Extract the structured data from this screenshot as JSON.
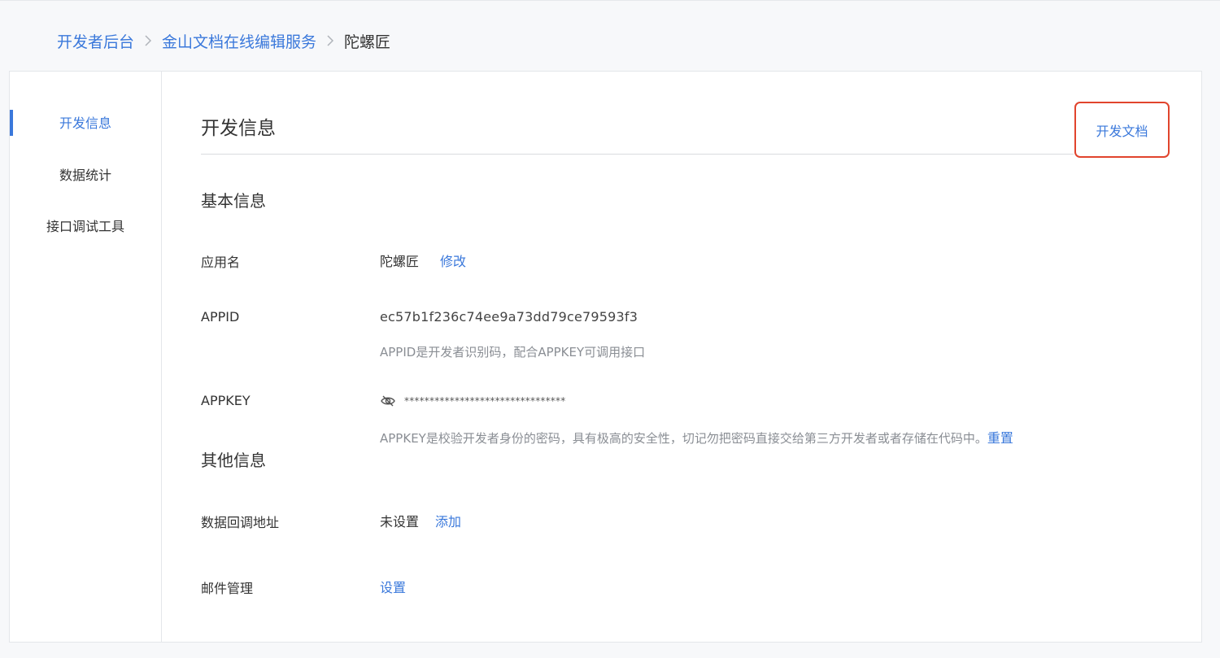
{
  "breadcrumb": {
    "items": [
      "开发者后台",
      "金山文档在线编辑服务"
    ],
    "current": "陀螺匠"
  },
  "sidebar": {
    "items": [
      {
        "label": "开发信息"
      },
      {
        "label": "数据统计"
      },
      {
        "label": "接口调试工具"
      }
    ]
  },
  "main": {
    "title": "开发信息",
    "doc_link": "开发文档",
    "basic": {
      "title": "基本信息",
      "app_name_label": "应用名",
      "app_name_value": "陀螺匠",
      "app_name_edit": "修改",
      "appid_label": "APPID",
      "appid_value": "ec57b1f236c74ee9a73dd79ce79593f3",
      "appid_hint": "APPID是开发者识别码，配合APPKEY可调用接口",
      "appkey_label": "APPKEY",
      "appkey_masked": "********************************",
      "appkey_hint": "APPKEY是校验开发者身份的密码，具有极高的安全性，切记勿把密码直接交给第三方开发者或者存储在代码中。",
      "appkey_reset": "重置"
    },
    "other": {
      "title": "其他信息",
      "callback_label": "数据回调地址",
      "callback_value": "未设置",
      "callback_add": "添加",
      "mail_label": "邮件管理",
      "mail_set": "设置"
    }
  },
  "colors": {
    "accent": "#3a78db",
    "highlight_box": "#e1442d",
    "background": "#f7f8fa"
  },
  "icons": [
    "chevron-right-icon",
    "eye-off-icon"
  ]
}
